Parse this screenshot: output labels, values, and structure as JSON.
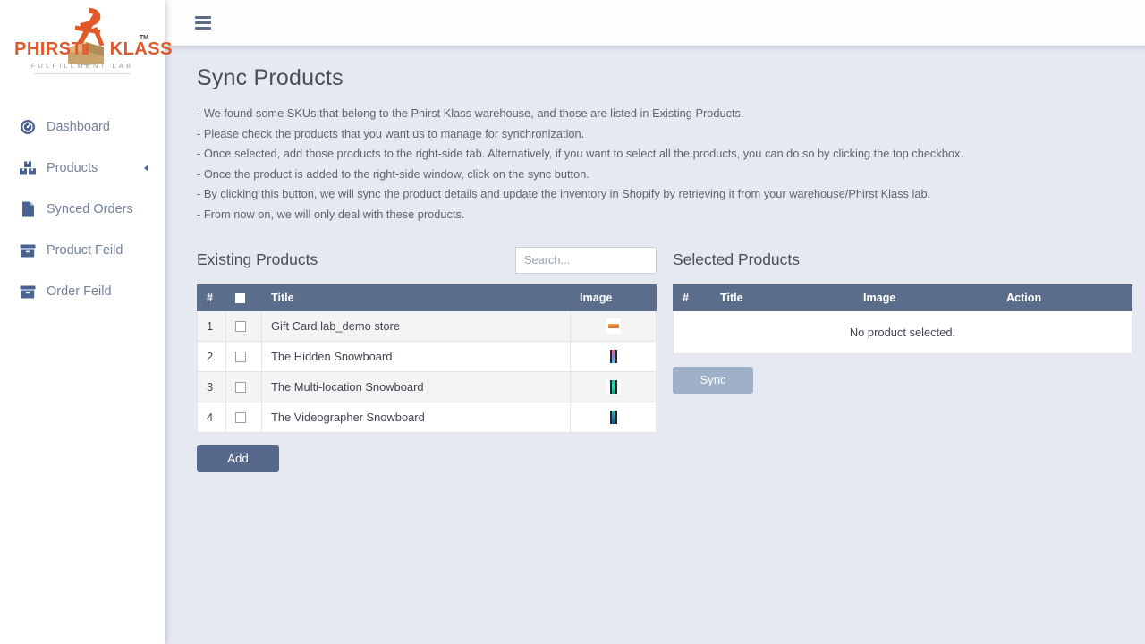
{
  "brand": {
    "name_left": "PHIRST",
    "name_right": "KLASS",
    "trademark": "TM",
    "tagline": "FULFILLMENT LAB",
    "color": "#e0592a"
  },
  "sidebar": {
    "items": [
      {
        "label": "Dashboard",
        "icon": "gauge-icon",
        "caret": false
      },
      {
        "label": "Products",
        "icon": "boxes-icon",
        "caret": true
      },
      {
        "label": "Synced Orders",
        "icon": "file-icon",
        "caret": false
      },
      {
        "label": "Product Feild",
        "icon": "archive-icon",
        "caret": false
      },
      {
        "label": "Order Feild",
        "icon": "archive-icon",
        "caret": false
      }
    ]
  },
  "topbar": {
    "menu_icon": "hamburger-icon"
  },
  "page": {
    "title": "Sync Products",
    "description": [
      "- We found some SKUs that belong to the Phirst Klass warehouse, and those are listed in Existing Products.",
      "- Please check the products that you want us to manage for synchronization.",
      "- Once selected, add those products to the right-side tab. Alternatively, if you want to select all the products, you can do so by clicking the top checkbox.",
      "- Once the product is added to the right-side window, click on the sync button.",
      "- By clicking this button, we will sync the product details and update the inventory in Shopify by retrieving it from your warehouse/Phirst Klass lab.",
      "- From now on, we will only deal with these products."
    ]
  },
  "existing_products": {
    "title": "Existing Products",
    "search": {
      "value": "",
      "placeholder": "Search..."
    },
    "columns": [
      "#",
      "",
      "Title",
      "Image"
    ],
    "select_all_checked": false,
    "rows": [
      {
        "num": "1",
        "checked": false,
        "title": "Gift Card lab_demo store",
        "image": "giftcard-thumbnail"
      },
      {
        "num": "2",
        "checked": false,
        "title": "The Hidden Snowboard",
        "image": "snowboard-pink-thumbnail"
      },
      {
        "num": "3",
        "checked": false,
        "title": "The Multi-location Snowboard",
        "image": "snowboard-green-thumbnail"
      },
      {
        "num": "4",
        "checked": false,
        "title": "The Videographer Snowboard",
        "image": "snowboard-teal-thumbnail"
      }
    ],
    "add_label": "Add"
  },
  "selected_products": {
    "title": "Selected Products",
    "columns": [
      "#",
      "Title",
      "Image",
      "Action"
    ],
    "empty_message": "No product selected.",
    "rows": [],
    "sync_label": "Sync"
  },
  "colors": {
    "table_header": "#5a6e8c",
    "add_button": "#56698c",
    "sync_button": "#9fb0c9",
    "content_bg": "#e6e9f1",
    "nav_icon": "#4a6291",
    "nav_label": "#73819b"
  }
}
